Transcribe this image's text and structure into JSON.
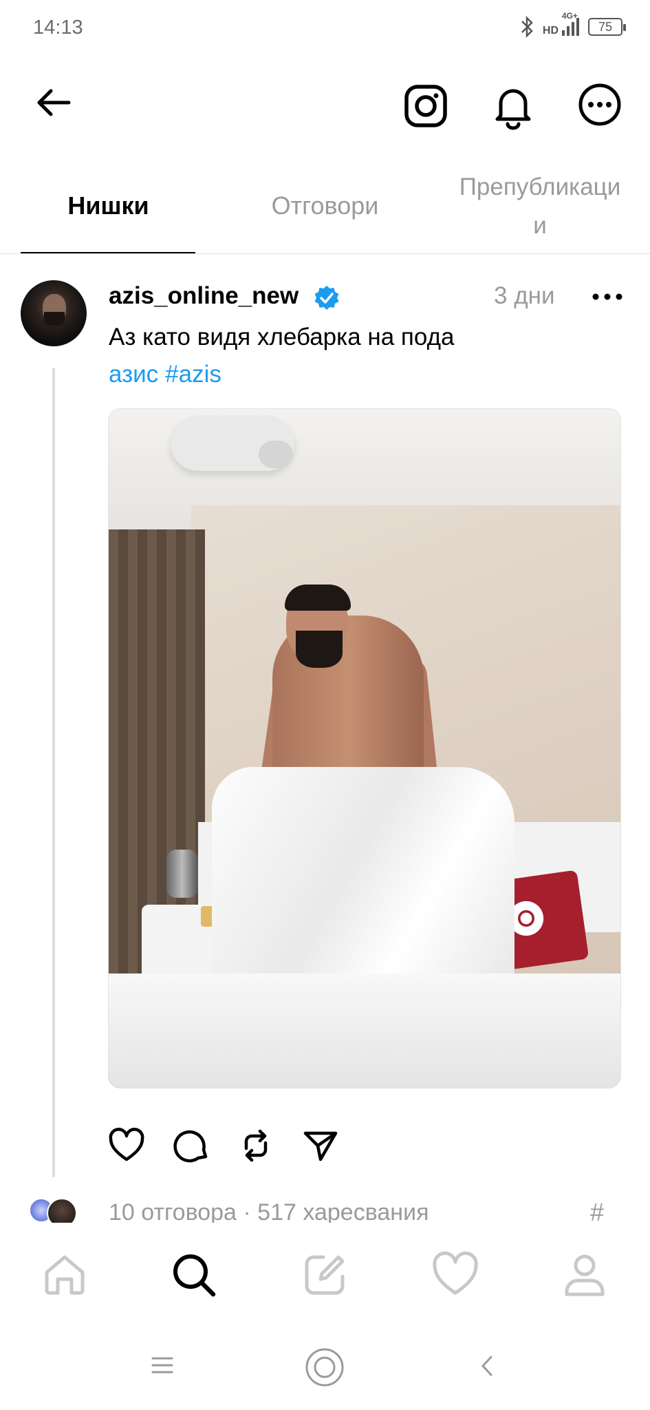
{
  "status_bar": {
    "time": "14:13",
    "network": "4G+",
    "hd_label": "HD",
    "battery": "75"
  },
  "header": {
    "back_icon": "arrow-left-icon",
    "instagram_icon": "instagram-icon",
    "notifications_icon": "bell-icon",
    "more_icon": "more-circle-icon"
  },
  "tabs": [
    {
      "label": "Нишки",
      "active": true
    },
    {
      "label": "Отговори",
      "active": false
    },
    {
      "label": "Препубликаци\nи",
      "active": false
    }
  ],
  "post": {
    "username": "azis_online_new",
    "verified": true,
    "time": "3 дни",
    "text": "Аз като видя хлебарка на пода",
    "tags": [
      "азис",
      "#azis"
    ],
    "image_description_icon": "photo-man-in-hotel-bed",
    "actions": {
      "like_icon": "heart-icon",
      "comment_icon": "comment-icon",
      "repost_icon": "repost-icon",
      "share_icon": "send-icon"
    },
    "stats": "10 отговора · 517 харесвания",
    "hash_icon": "#"
  },
  "bottom_nav": [
    {
      "name": "home",
      "icon": "home-icon",
      "active": false
    },
    {
      "name": "search",
      "icon": "search-icon",
      "active": true
    },
    {
      "name": "compose",
      "icon": "compose-icon",
      "active": false
    },
    {
      "name": "activity",
      "icon": "heart-icon",
      "active": false
    },
    {
      "name": "profile",
      "icon": "person-icon",
      "active": false
    }
  ],
  "colors": {
    "link": "#1d9bf0",
    "muted": "#9a9a9a",
    "verified": "#1d9bf0",
    "inactive_icon": "#c8c8c8"
  }
}
